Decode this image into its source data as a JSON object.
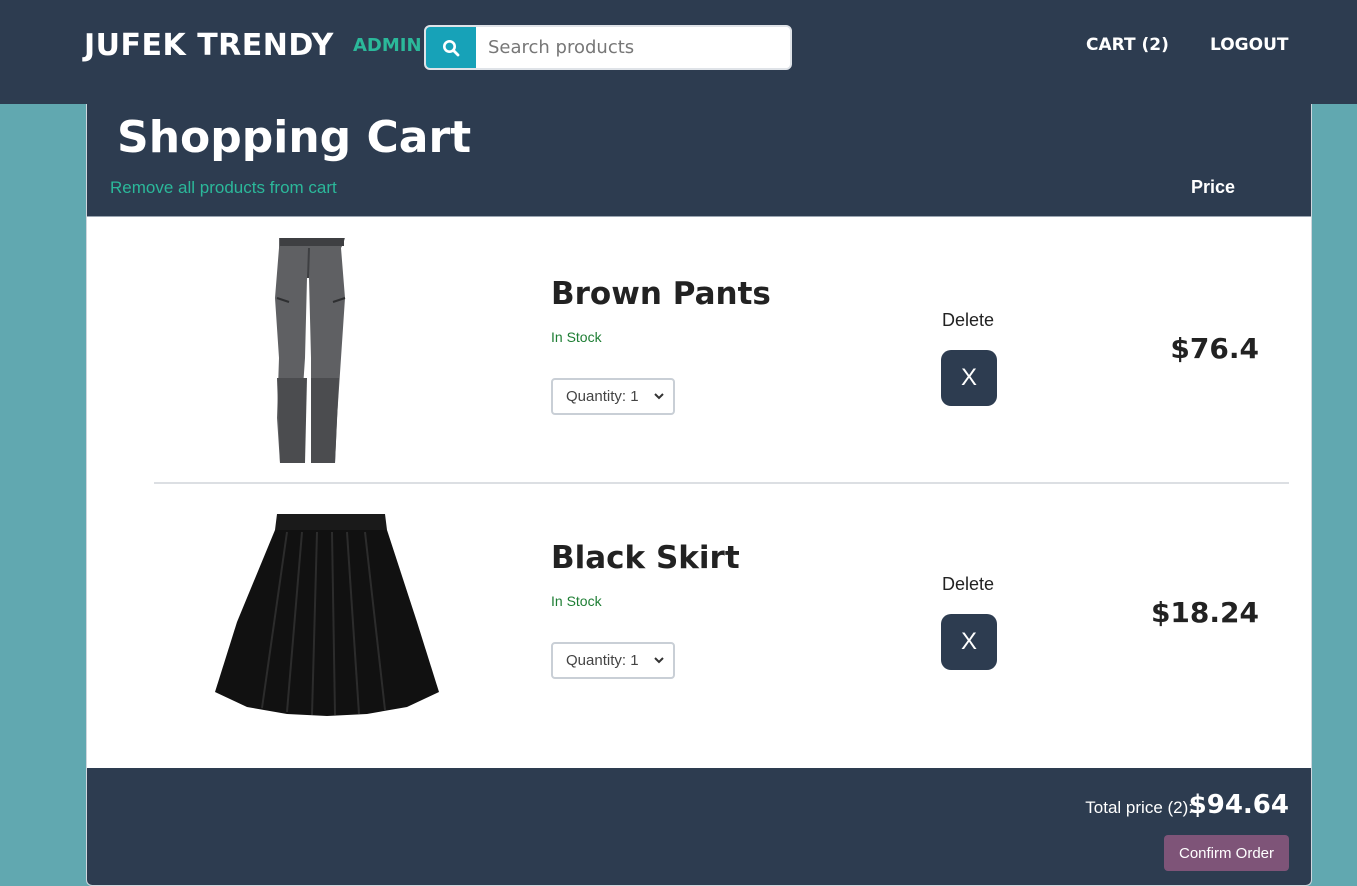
{
  "navbar": {
    "brand": "JUFEK TRENDY",
    "admin_label": "ADMIN",
    "search_placeholder": "Search products",
    "cart_label": "CART (2)",
    "logout_label": "LOGOUT"
  },
  "cart": {
    "title": "Shopping Cart",
    "remove_all_label": "Remove all products from cart",
    "price_header": "Price",
    "items": [
      {
        "name": "Brown Pants",
        "stock": "In Stock",
        "quantity_label": "Quantity: 1",
        "delete_label": "Delete",
        "delete_button": "X",
        "price": "$76.4"
      },
      {
        "name": "Black Skirt",
        "stock": "In Stock",
        "quantity_label": "Quantity: 1",
        "delete_label": "Delete",
        "delete_button": "X",
        "price": "$18.24"
      }
    ],
    "total_label": "Total price (2):",
    "total_value": "$94.64",
    "confirm_label": "Confirm Order"
  },
  "colors": {
    "navbar": "#2d3c50",
    "accent_teal": "#2bb89a",
    "search_button": "#17a2b8",
    "background": "#61a8b0",
    "confirm_button": "#7e5478"
  }
}
